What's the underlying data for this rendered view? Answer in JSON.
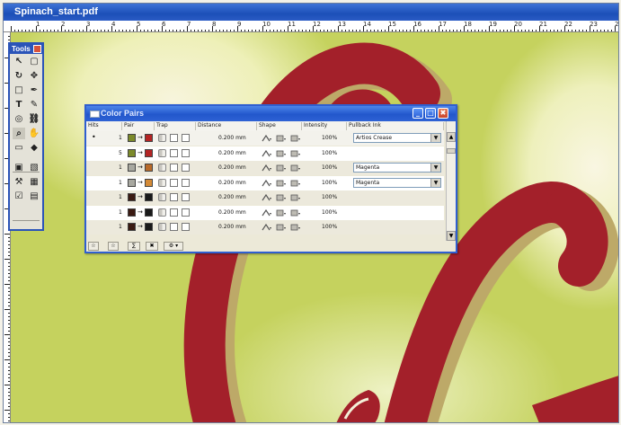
{
  "window": {
    "title": "Spinach_start.pdf"
  },
  "ruler": {
    "h_numbers": [
      "1",
      "2",
      "3",
      "4",
      "5",
      "6",
      "7",
      "8",
      "9",
      "10",
      "11",
      "12",
      "13",
      "14",
      "15",
      "16",
      "17",
      "18",
      "19",
      "20",
      "21",
      "22",
      "23",
      "24",
      "25",
      "26",
      "27"
    ]
  },
  "tools_palette": {
    "title": "Tools",
    "icons": [
      "select-arrow-icon",
      "object-select-icon",
      "rotate-icon",
      "pan-icon",
      "rectangle-icon",
      "eyedropper-icon",
      "text-icon",
      "text-edit-icon",
      "globe-icon",
      "link-icon",
      "zoom-icon",
      "hand-icon",
      "crop-icon",
      "marker-icon",
      "trap-icon",
      "color-pairs-icon",
      "touchup-icon",
      "color-icon",
      "preflight-icon",
      "page-icon"
    ]
  },
  "color_pairs": {
    "title": "Color Pairs",
    "columns": [
      "Hits",
      "Pair",
      "Trap",
      "Distance",
      "Shape",
      "Intensity",
      "Pullback Ink"
    ],
    "rows": [
      {
        "hits": "1",
        "marker": "•",
        "swatch_a": "#7c8a2a",
        "swatch_b": "#b42424",
        "distance": "0.200 mm",
        "intensity": "100%",
        "pullback": "Artios Crease"
      },
      {
        "hits": "5",
        "marker": "",
        "swatch_a": "#7c8a2a",
        "swatch_b": "#b42424",
        "distance": "0.200 mm",
        "intensity": "100%",
        "pullback": ""
      },
      {
        "hits": "1",
        "marker": "",
        "swatch_a": "#a8a8a0",
        "swatch_b": "#b86a2a",
        "distance": "0.200 mm",
        "intensity": "100%",
        "pullback": "Magenta"
      },
      {
        "hits": "1",
        "marker": "",
        "swatch_a": "#a8a8a0",
        "swatch_b": "#d48a36",
        "distance": "0.200 mm",
        "intensity": "100%",
        "pullback": "Magenta"
      },
      {
        "hits": "1",
        "marker": "",
        "swatch_a": "#3a1a12",
        "swatch_b": "#1a1a1a",
        "distance": "0.200 mm",
        "intensity": "100%",
        "pullback": ""
      },
      {
        "hits": "1",
        "marker": "",
        "swatch_a": "#3a1a12",
        "swatch_b": "#1a1a1a",
        "distance": "0.200 mm",
        "intensity": "100%",
        "pullback": ""
      },
      {
        "hits": "1",
        "marker": "",
        "swatch_a": "#3a1a12",
        "swatch_b": "#1a1a1a",
        "distance": "0.200 mm",
        "intensity": "100%",
        "pullback": ""
      }
    ],
    "arrow": "→",
    "dropdown_arrow": "▼",
    "footer_buttons": [
      "☆",
      "☆",
      "∑",
      "✖",
      "⚙ ▾"
    ],
    "scroll_up": "▲",
    "scroll_down": "▼",
    "window_buttons": {
      "minimize": "_",
      "maximize": "□",
      "close": "✖"
    }
  },
  "colors": {
    "artwork_red": "#a3202a",
    "artwork_shadow": "#bda968",
    "canvas_green": "#c5d25e",
    "title_blue": "#2257cc"
  }
}
